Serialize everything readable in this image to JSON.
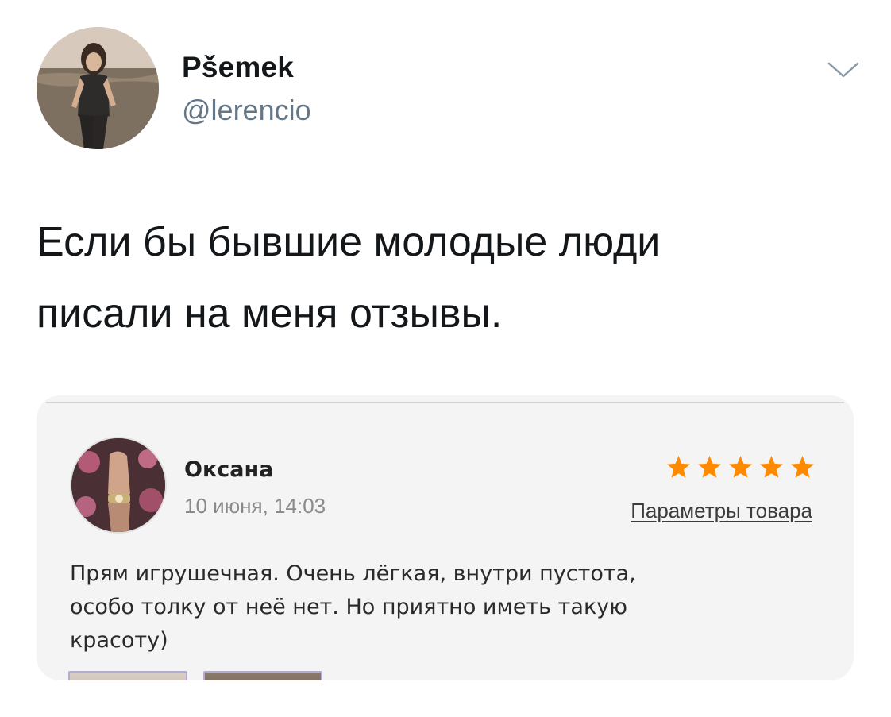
{
  "tweet": {
    "author": {
      "display_name": "Pšemek",
      "handle": "@lerencio",
      "avatar_icon": "profile-photo"
    },
    "menu_icon": "chevron-down-icon",
    "text_lines": [
      "Если бы бывшие молодые люди",
      "писали на меня отзывы."
    ]
  },
  "review": {
    "reviewer_name": "Оксана",
    "date": "10 июня, 14:03",
    "rating": 5,
    "rating_max": 5,
    "star_color": "#ff8a00",
    "params_link": "Параметры товара",
    "text_lines": [
      "Прям игрушечная. Очень лёгкая, внутри пустота,",
      "особо толку от неё нет. Но приятно иметь такую",
      "красоту)"
    ]
  },
  "colors": {
    "name": "#14171a",
    "handle": "#657786",
    "card_bg": "#f4f4f4"
  }
}
